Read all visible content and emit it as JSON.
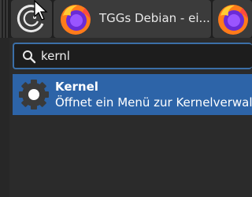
{
  "taskbar": {
    "launcher_icon": "swirl-logo-icon",
    "active_window": {
      "icon": "firefox-icon",
      "title": "TGGs Debian - ei..."
    },
    "second_window": {
      "icon": "firefox-icon"
    }
  },
  "search": {
    "icon": "search-icon",
    "value": "kernl"
  },
  "results": [
    {
      "icon": "gear-icon",
      "title": "Kernel",
      "description": "Öffnet ein Menü zur Kernelverwalt"
    }
  ],
  "colors": {
    "taskbar_bg": "#1f1f1f",
    "button_bg": "#3b3b3b",
    "panel_bg": "#2b2b2b",
    "search_border": "#3b6fa8",
    "selection": "#2d64a8"
  }
}
